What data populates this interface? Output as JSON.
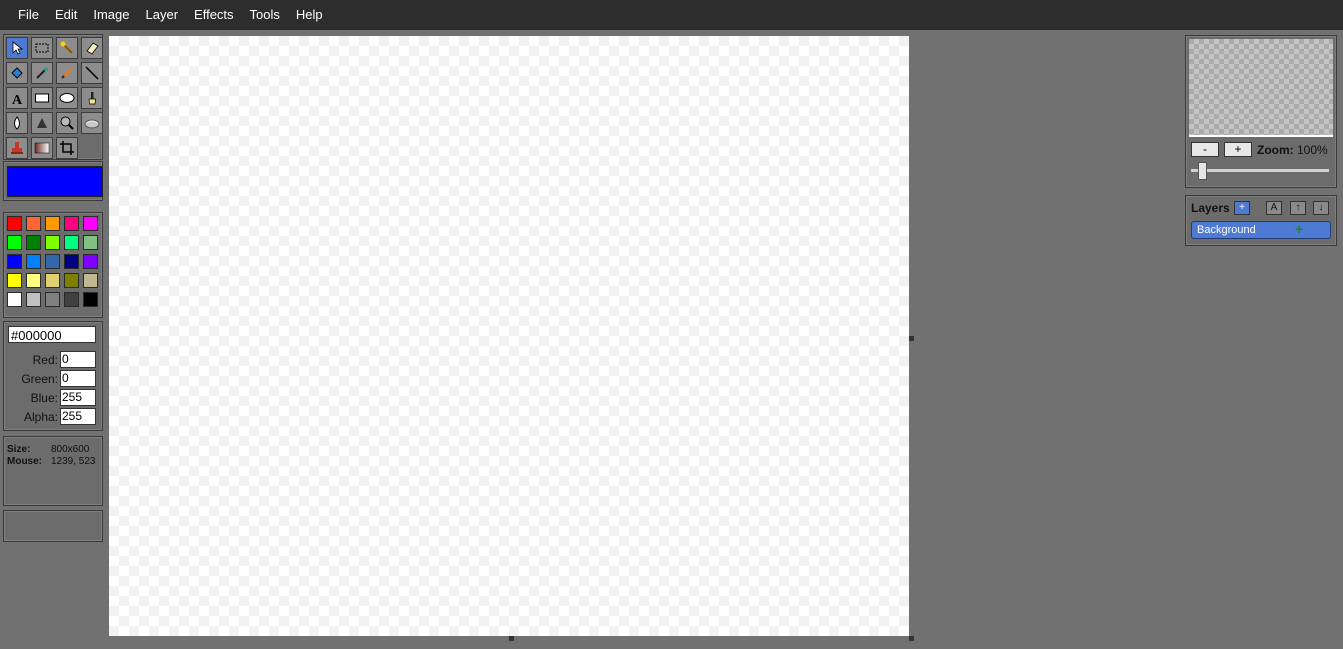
{
  "menu": [
    "File",
    "Edit",
    "Image",
    "Layer",
    "Effects",
    "Tools",
    "Help"
  ],
  "tools": [
    {
      "name": "select-tool",
      "icon": "arrow-icon",
      "active": true
    },
    {
      "name": "rect-select-tool",
      "icon": "marquee-icon"
    },
    {
      "name": "magic-wand-tool",
      "icon": "wand-icon"
    },
    {
      "name": "eraser-tool",
      "icon": "eraser-icon"
    },
    {
      "name": "fill-tool",
      "icon": "paint-bucket-icon"
    },
    {
      "name": "color-picker-tool",
      "icon": "eyedropper-icon"
    },
    {
      "name": "pencil-tool",
      "icon": "pencil-icon"
    },
    {
      "name": "line-tool",
      "icon": "line-icon"
    },
    {
      "name": "text-tool",
      "icon": "text-icon"
    },
    {
      "name": "rectangle-tool",
      "icon": "rectangle-icon"
    },
    {
      "name": "ellipse-tool",
      "icon": "ellipse-icon"
    },
    {
      "name": "brush-tool",
      "icon": "brush-icon"
    },
    {
      "name": "blur-tool",
      "icon": "drop-icon"
    },
    {
      "name": "sharpen-tool",
      "icon": "triangle-icon"
    },
    {
      "name": "zoom-tool",
      "icon": "magnifier-icon"
    },
    {
      "name": "smudge-tool",
      "icon": "smudge-icon"
    },
    {
      "name": "clone-tool",
      "icon": "stamp-icon"
    },
    {
      "name": "gradient-tool",
      "icon": "gradient-icon"
    },
    {
      "name": "crop-tool",
      "icon": "crop-icon"
    }
  ],
  "foreground_color": "#0000ff",
  "palette": [
    [
      "#ff0000",
      "#ff6633",
      "#ff9900",
      "#ff0080",
      "#ff00ff"
    ],
    [
      "#00ff00",
      "#008000",
      "#80ff00",
      "#00ff80",
      "#80c080"
    ],
    [
      "#0000ff",
      "#0080ff",
      "#3366aa",
      "#000080",
      "#8000ff"
    ],
    [
      "#ffff00",
      "#ffff80",
      "#e0d070",
      "#808000",
      "#c0b890"
    ],
    [
      "#ffffff",
      "#c0c0c0",
      "#808080",
      "#404040",
      "#000000"
    ]
  ],
  "color_input": {
    "hex": "#000000",
    "red_label": "Red:",
    "red": "0",
    "green_label": "Green:",
    "green": "0",
    "blue_label": "Blue:",
    "blue": "255",
    "alpha_label": "Alpha:",
    "alpha": "255"
  },
  "info": {
    "size_label": "Size:",
    "size": "800x600",
    "mouse_label": "Mouse:",
    "mouse": "1239, 523"
  },
  "navigator": {
    "minus": "-",
    "plus": "+",
    "zoom_label": "Zoom:",
    "zoom_value": "100%"
  },
  "layers": {
    "title": "Layers",
    "add": "+",
    "btn_a": "A",
    "btn_up": "↑",
    "btn_down": "↓",
    "items": [
      {
        "name": "Background",
        "plus": "+"
      }
    ]
  }
}
